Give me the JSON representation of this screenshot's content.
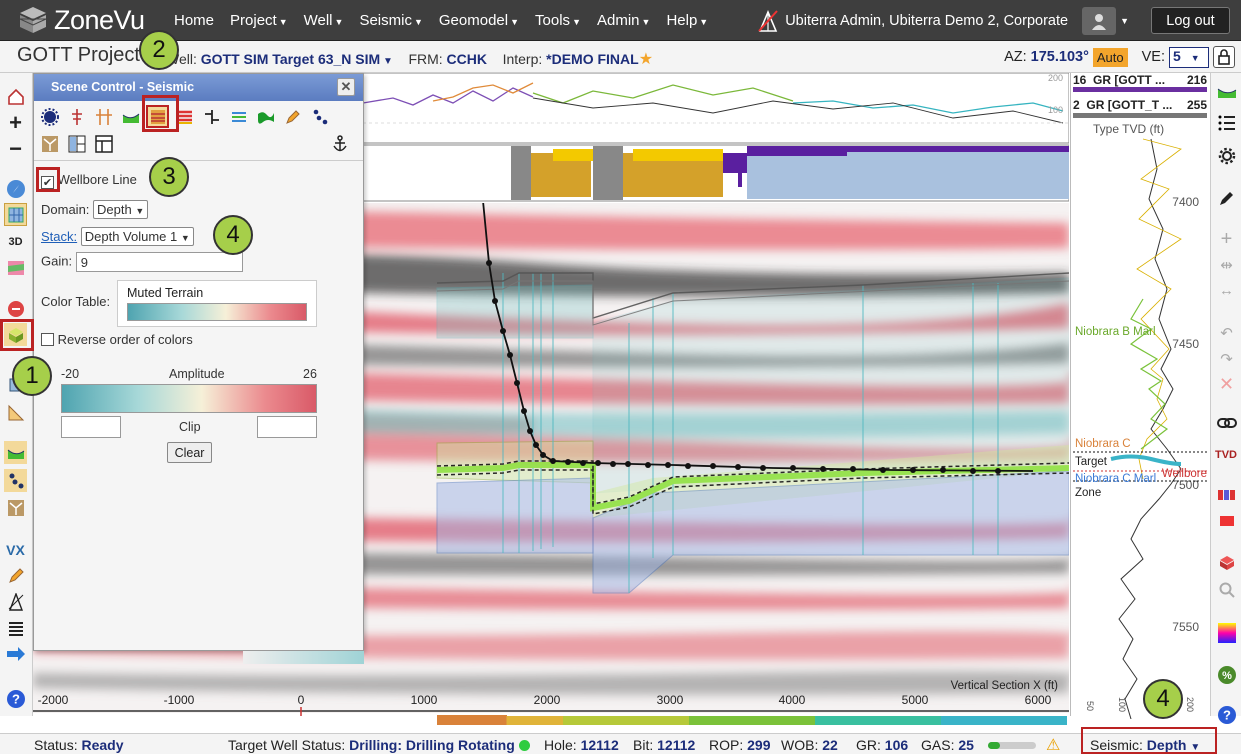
{
  "app": {
    "brand": "ZoneVu",
    "user": "Ubiterra Admin, Ubiterra Demo 2, Corporate",
    "logout": "Log out"
  },
  "menu": [
    "Home",
    "Project",
    "Well",
    "Seismic",
    "Geomodel",
    "Tools",
    "Admin",
    "Help"
  ],
  "bar2": {
    "project": "GOTT Project",
    "well_label": "Well:",
    "well": "GOTT SIM Target 63_N SIM",
    "frm_label": "FRM:",
    "frm": "CCHK",
    "interp_label": "Interp:",
    "interp": "*DEMO FINAL",
    "az_label": "AZ:",
    "az": "175.103°",
    "auto": "Auto",
    "ve_label": "VE:",
    "ve": "5"
  },
  "panel": {
    "title": "Scene Control - Seismic",
    "wellbore_line": "Wellbore Line",
    "domain_label": "Domain:",
    "domain": "Depth",
    "stack_label": "Stack:",
    "stack": "Depth Volume 1",
    "gain_label": "Gain:",
    "gain": "9",
    "color_table_label": "Color Table:",
    "color_table": "Muted Terrain",
    "reverse": "Reverse order of colors",
    "amp_min": "-20",
    "amp_label": "Amplitude",
    "amp_max": "26",
    "clip": "Clip",
    "clear": "Clear"
  },
  "xaxis": {
    "ticks": [
      "-2000",
      "-1000",
      "0",
      "1000",
      "2000",
      "3000",
      "4000",
      "5000",
      "6000"
    ],
    "label": "Vertical Section X (ft)"
  },
  "welllog": {
    "track1": {
      "num": "16",
      "name": "GR [GOTT ...",
      "val": "216"
    },
    "track2": {
      "num": "2",
      "name": "GR [GOTT_T ...",
      "val": "255"
    },
    "type_tvd": "Type TVD (ft)",
    "depths": [
      "7400",
      "7450",
      "7500",
      "7550"
    ],
    "zones": {
      "niobrara_b": "Niobrara B Marl",
      "niobrara_c_chalk": "Niobrara C",
      "target": "Target",
      "wellbore": "Wellbore",
      "niobrara_c_marl": "Niobrara C Marl",
      "zone": "Zone"
    },
    "bottom_ticks": [
      "50",
      "100",
      "150",
      "200"
    ],
    "top_scale": [
      "200",
      "100"
    ]
  },
  "status": {
    "status_label": "Status:",
    "status": "Ready",
    "target_label": "Target Well Status:",
    "target": "Drilling: Drilling Rotating",
    "hole_label": "Hole:",
    "hole": "12112",
    "bit_label": "Bit:",
    "bit": "12112",
    "rop_label": "ROP:",
    "rop": "299",
    "wob_label": "WOB:",
    "wob": "22",
    "gr_label": "GR:",
    "gr": "106",
    "gas_label": "GAS:",
    "gas": "25",
    "seismic_label": "Seismic:",
    "seismic": "Depth"
  },
  "callouts": [
    "1",
    "2",
    "3",
    "4",
    "4"
  ],
  "colors": {
    "nav": "#3e3e3e",
    "accent": "#1c2d7a",
    "callout": "#a6cf4a",
    "highlight": "#b22222",
    "horizon": "#8ee040"
  }
}
